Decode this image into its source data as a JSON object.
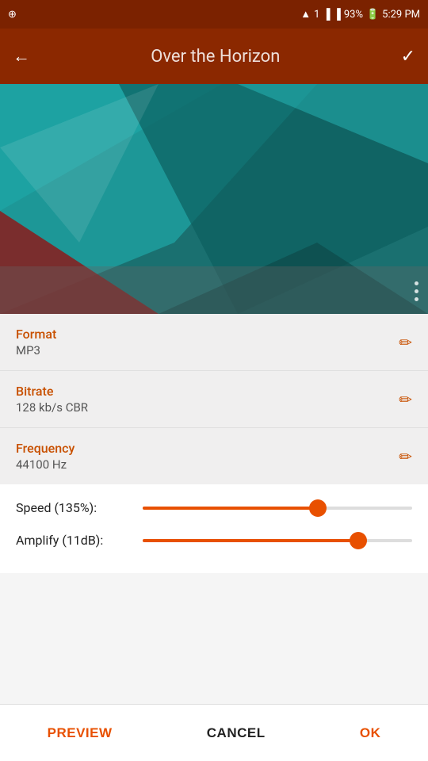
{
  "statusBar": {
    "time": "5:29 PM",
    "battery": "93%",
    "wifi": true,
    "signal": true
  },
  "appBar": {
    "title": "Over the Horizon",
    "backLabel": "←",
    "confirmLabel": "✓"
  },
  "settings": [
    {
      "label": "Format",
      "value": "MP3"
    },
    {
      "label": "Bitrate",
      "value": "128 kb/s CBR"
    },
    {
      "label": "Frequency",
      "value": "44100 Hz"
    }
  ],
  "sliders": [
    {
      "label": "Speed (135%):",
      "percent": 65
    },
    {
      "label": "Amplify (11dB):",
      "percent": 80
    }
  ],
  "actions": {
    "preview": "PREVIEW",
    "cancel": "CANCEL",
    "ok": "OK"
  }
}
